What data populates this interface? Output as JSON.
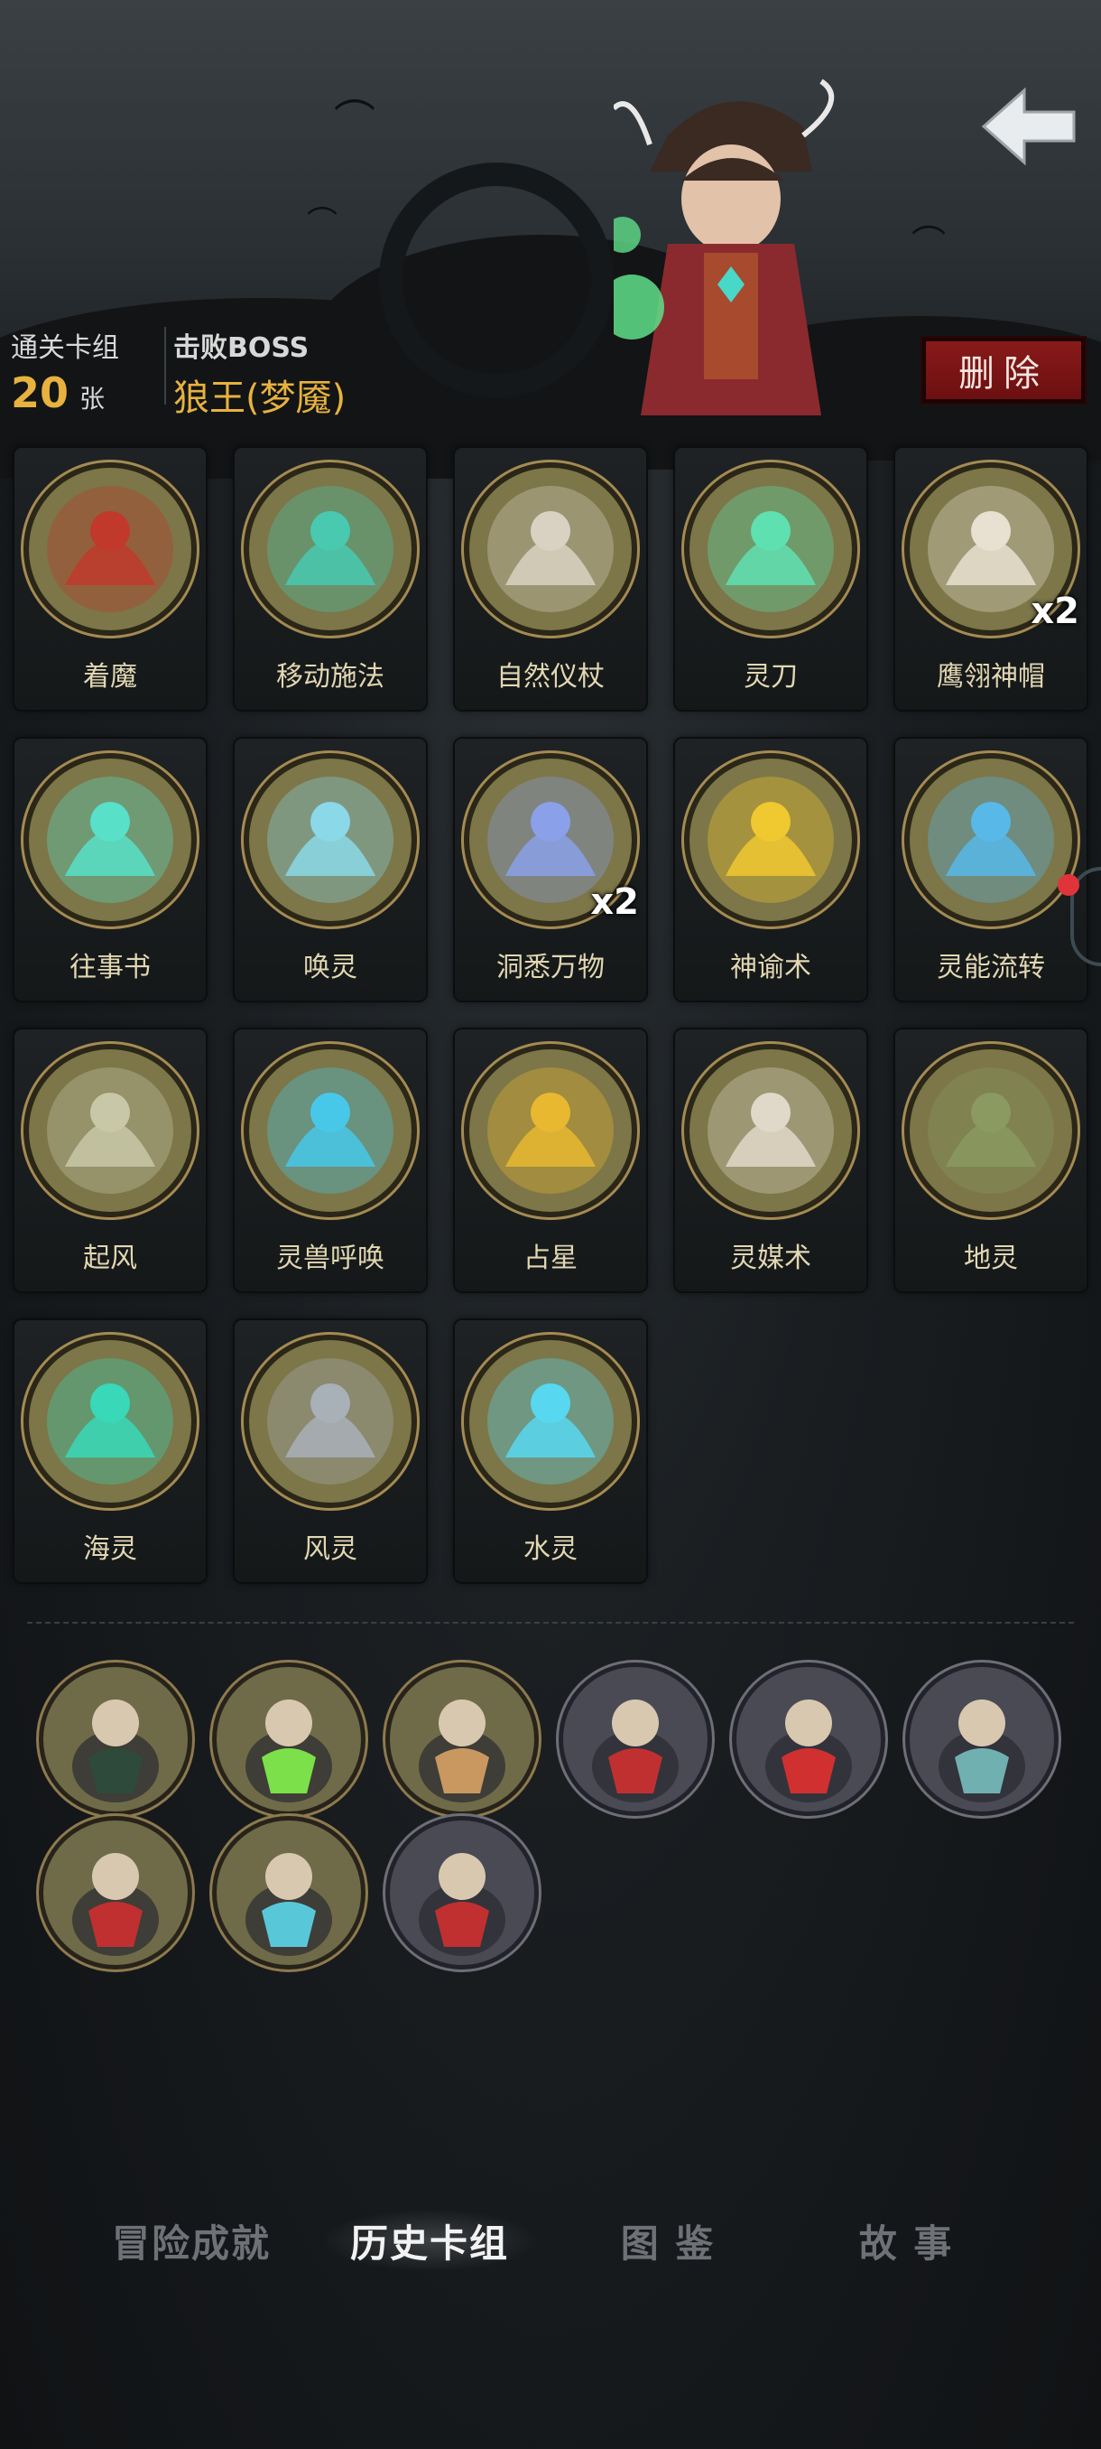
{
  "header": {
    "cleared_deck_label": "通关卡组",
    "card_count": "20",
    "card_unit": "张",
    "defeated_boss_label": "击败BOSS",
    "boss_name": "狼王(梦魇)",
    "delete_label": "删除"
  },
  "cards": [
    {
      "name": "着魔",
      "count": "",
      "icon": "possessed-icon",
      "tint": "#c0392b"
    },
    {
      "name": "移动施法",
      "count": "",
      "icon": "wizard-icon",
      "tint": "#48c9b0"
    },
    {
      "name": "自然仪杖",
      "count": "",
      "icon": "staff-icon",
      "tint": "#d9d2c2"
    },
    {
      "name": "灵刀",
      "count": "",
      "icon": "spirit-blade-icon",
      "tint": "#5fe0b0"
    },
    {
      "name": "鹰翎神帽",
      "count": "x2",
      "icon": "feather-hat-icon",
      "tint": "#e8e0d0"
    },
    {
      "name": "往事书",
      "count": "",
      "icon": "book-icon",
      "tint": "#58e0c8"
    },
    {
      "name": "唤灵",
      "count": "",
      "icon": "summon-spirit-icon",
      "tint": "#8ad8e8"
    },
    {
      "name": "洞悉万物",
      "count": "x2",
      "icon": "crystal-ball-icon",
      "tint": "#8aa0e8"
    },
    {
      "name": "神谕术",
      "count": "",
      "icon": "oracle-icon",
      "tint": "#f0c830"
    },
    {
      "name": "灵能流转",
      "count": "",
      "icon": "psychic-flow-icon",
      "tint": "#58b8e8"
    },
    {
      "name": "起风",
      "count": "",
      "icon": "wind-rise-icon",
      "tint": "#c8c8a8"
    },
    {
      "name": "灵兽呼唤",
      "count": "",
      "icon": "spirit-beast-icon",
      "tint": "#48c8e8"
    },
    {
      "name": "占星",
      "count": "",
      "icon": "astrology-icon",
      "tint": "#e8b830"
    },
    {
      "name": "灵媒术",
      "count": "",
      "icon": "skull-icon",
      "tint": "#e0d8c8"
    },
    {
      "name": "地灵",
      "count": "",
      "icon": "earth-spirit-icon",
      "tint": "#8a9a60"
    },
    {
      "name": "海灵",
      "count": "",
      "icon": "sea-spirit-icon",
      "tint": "#38d8b8"
    },
    {
      "name": "风灵",
      "count": "",
      "icon": "tornado-icon",
      "tint": "#a8b0b8"
    },
    {
      "name": "水灵",
      "count": "",
      "icon": "water-spirit-icon",
      "tint": "#58d8f0"
    }
  ],
  "relics": [
    {
      "icon": "totem-relic-icon",
      "grey": false,
      "tint": "#2e4a3a"
    },
    {
      "icon": "witch-relic-icon",
      "grey": false,
      "tint": "#7be04a"
    },
    {
      "icon": "scroll-relic-icon",
      "grey": false,
      "tint": "#c89860"
    },
    {
      "icon": "bleeding-fist-relic-icon",
      "grey": true,
      "tint": "#c03030"
    },
    {
      "icon": "vampire-relic-icon",
      "grey": true,
      "tint": "#d03030"
    },
    {
      "icon": "gargoyle-relic-icon",
      "grey": true,
      "tint": "#70b0b0"
    },
    {
      "icon": "dracula-relic-icon",
      "grey": false,
      "tint": "#c03030"
    },
    {
      "icon": "mirror-hand-relic-icon",
      "grey": false,
      "tint": "#58c8d8"
    },
    {
      "icon": "bleeding-fist-relic-icon",
      "grey": true,
      "tint": "#c03030"
    }
  ],
  "tabs": [
    {
      "label": "冒险成就",
      "active": false
    },
    {
      "label": "历史卡组",
      "active": true
    },
    {
      "label": "图 鉴",
      "active": false
    },
    {
      "label": "故 事",
      "active": false
    }
  ],
  "colors": {
    "accent_gold": "#e7b23e",
    "delete_red": "#7a1414",
    "card_disc": "#7c7648"
  }
}
